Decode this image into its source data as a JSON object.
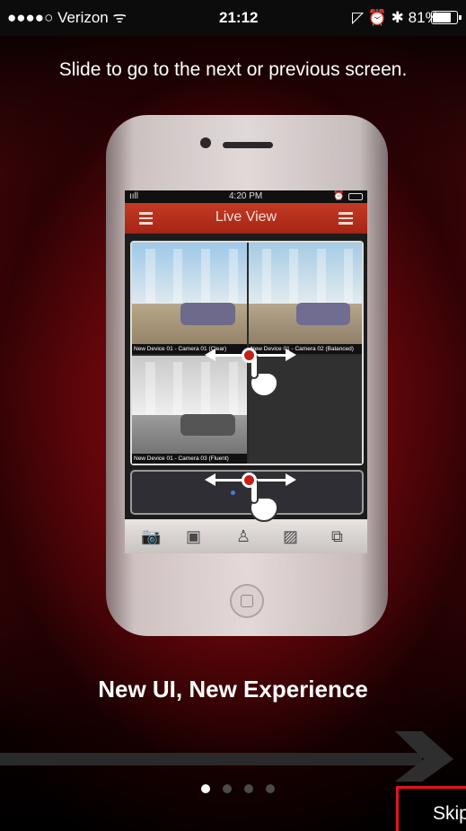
{
  "status_bar": {
    "carrier": "●●●●○ Verizon ᯤ",
    "time": "21:12",
    "right_icons": "◸ ⏰ ✱ 81%",
    "battery_level": 0.81
  },
  "instruction": "Slide to go to the next or previous screen.",
  "phone_screen": {
    "signal": "ııll",
    "time": "4:20 PM",
    "title": "Live View",
    "cameras": [
      {
        "label": "New Device 01 - Camera 01 (Clear)"
      },
      {
        "label": "New Device 01 - Camera 02 (Balanced)"
      },
      {
        "label": "New Device 01 - Camera 03 (Fluent)"
      }
    ],
    "toolbar_icons": [
      "camera-icon",
      "record-icon",
      "ptz-icon",
      "quality-icon",
      "close-view-icon"
    ]
  },
  "heading": "New UI, New Experience",
  "pagination": {
    "pages": 4,
    "current": 0
  },
  "skip_label": "Skip"
}
